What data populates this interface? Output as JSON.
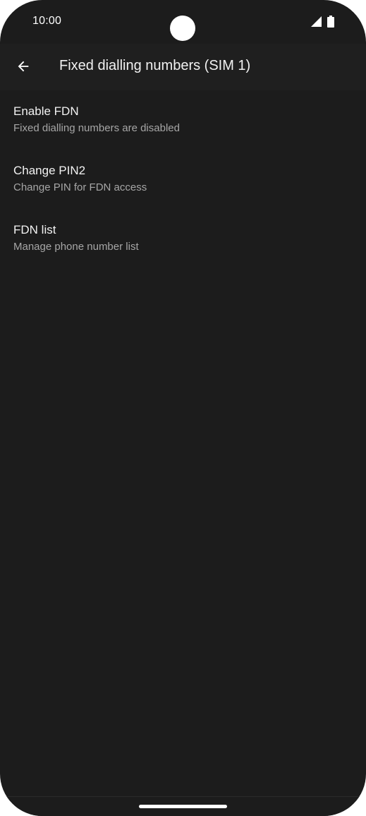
{
  "status_bar": {
    "time": "10:00",
    "icons": [
      "camera-cutout",
      "signal-icon",
      "battery-icon"
    ]
  },
  "app_bar": {
    "back_icon": "arrow-back-icon",
    "title": "Fixed dialling numbers (SIM 1)"
  },
  "settings": {
    "items": [
      {
        "title": "Enable FDN",
        "summary": "Fixed dialling numbers are disabled"
      },
      {
        "title": "Change PIN2",
        "summary": "Change PIN for FDN access"
      },
      {
        "title": "FDN list",
        "summary": "Manage phone number list"
      }
    ]
  },
  "colors": {
    "background": "#1c1c1c",
    "app_bar": "#1f1f1f",
    "title_text": "#f2f2f2",
    "summary_text": "#a6a6a6"
  }
}
